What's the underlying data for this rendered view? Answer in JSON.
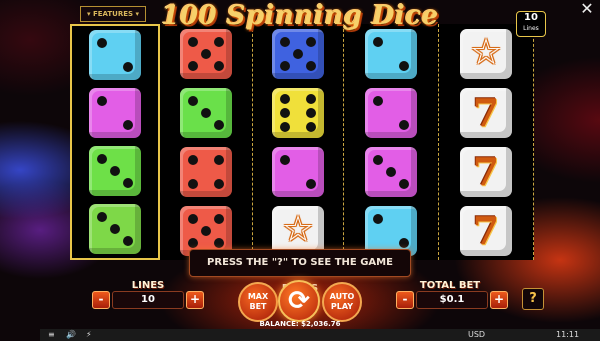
{
  "game": {
    "title": "100 Spinning Dice",
    "features_label": "FEATURES",
    "lines_badge": {
      "value": "10",
      "label": "Lines"
    },
    "close_glyph": "✕"
  },
  "reels": [
    [
      {
        "type": "die",
        "color": "#5fd0f2",
        "pips": 2
      },
      {
        "type": "die",
        "color": "#e25ee6",
        "pips": 2
      },
      {
        "type": "die",
        "color": "#6ee048",
        "pips": 3
      },
      {
        "type": "die",
        "color": "#7ed848",
        "pips": 3
      }
    ],
    [
      {
        "type": "die",
        "color": "#ee5a48",
        "pips": 5
      },
      {
        "type": "die",
        "color": "#6ae04a",
        "pips": 3
      },
      {
        "type": "die",
        "color": "#ee5a48",
        "pips": 4
      },
      {
        "type": "die",
        "color": "#ee5a48",
        "pips": 5
      }
    ],
    [
      {
        "type": "die",
        "color": "#3f62e0",
        "pips": 5
      },
      {
        "type": "die",
        "color": "#f0e03a",
        "pips": 6
      },
      {
        "type": "die",
        "color": "#e25ee6",
        "pips": 2
      },
      {
        "type": "die",
        "color": "#f2f2f2",
        "pips": 0,
        "icon": "star-icon"
      }
    ],
    [
      {
        "type": "die",
        "color": "#5fd0f2",
        "pips": 2
      },
      {
        "type": "die",
        "color": "#e25ee6",
        "pips": 2
      },
      {
        "type": "die",
        "color": "#e25ee6",
        "pips": 3
      },
      {
        "type": "die",
        "color": "#5fd0f2",
        "pips": 2
      }
    ],
    [
      {
        "type": "die",
        "color": "#f2f2f2",
        "pips": 0,
        "icon": "star-icon"
      },
      {
        "type": "die",
        "color": "#f2f2f2",
        "pips": 0,
        "icon": "seven-icon"
      },
      {
        "type": "die",
        "color": "#f2f2f2",
        "pips": 0,
        "icon": "seven-icon"
      },
      {
        "type": "die",
        "color": "#f2f2f2",
        "pips": 0,
        "icon": "seven-icon"
      }
    ]
  ],
  "rules_banner": "PRESS THE \"?\" TO SEE THE GAME RULES",
  "controls": {
    "lines_label": "LINES",
    "lines_value": "10",
    "minus": "-",
    "plus": "+",
    "max_bet": "MAX BET",
    "auto_play": "AUTO PLAY",
    "spin_glyph": "⟳",
    "total_bet_label": "TOTAL BET",
    "total_bet_value": "$0.1",
    "help": "?"
  },
  "balance": "BALANCE: $2,036.76",
  "statusbar": {
    "currency": "USD",
    "time": "11:11",
    "menu_glyph": "≡",
    "sound_glyph": "🔊",
    "turbo_glyph": "⚡"
  }
}
